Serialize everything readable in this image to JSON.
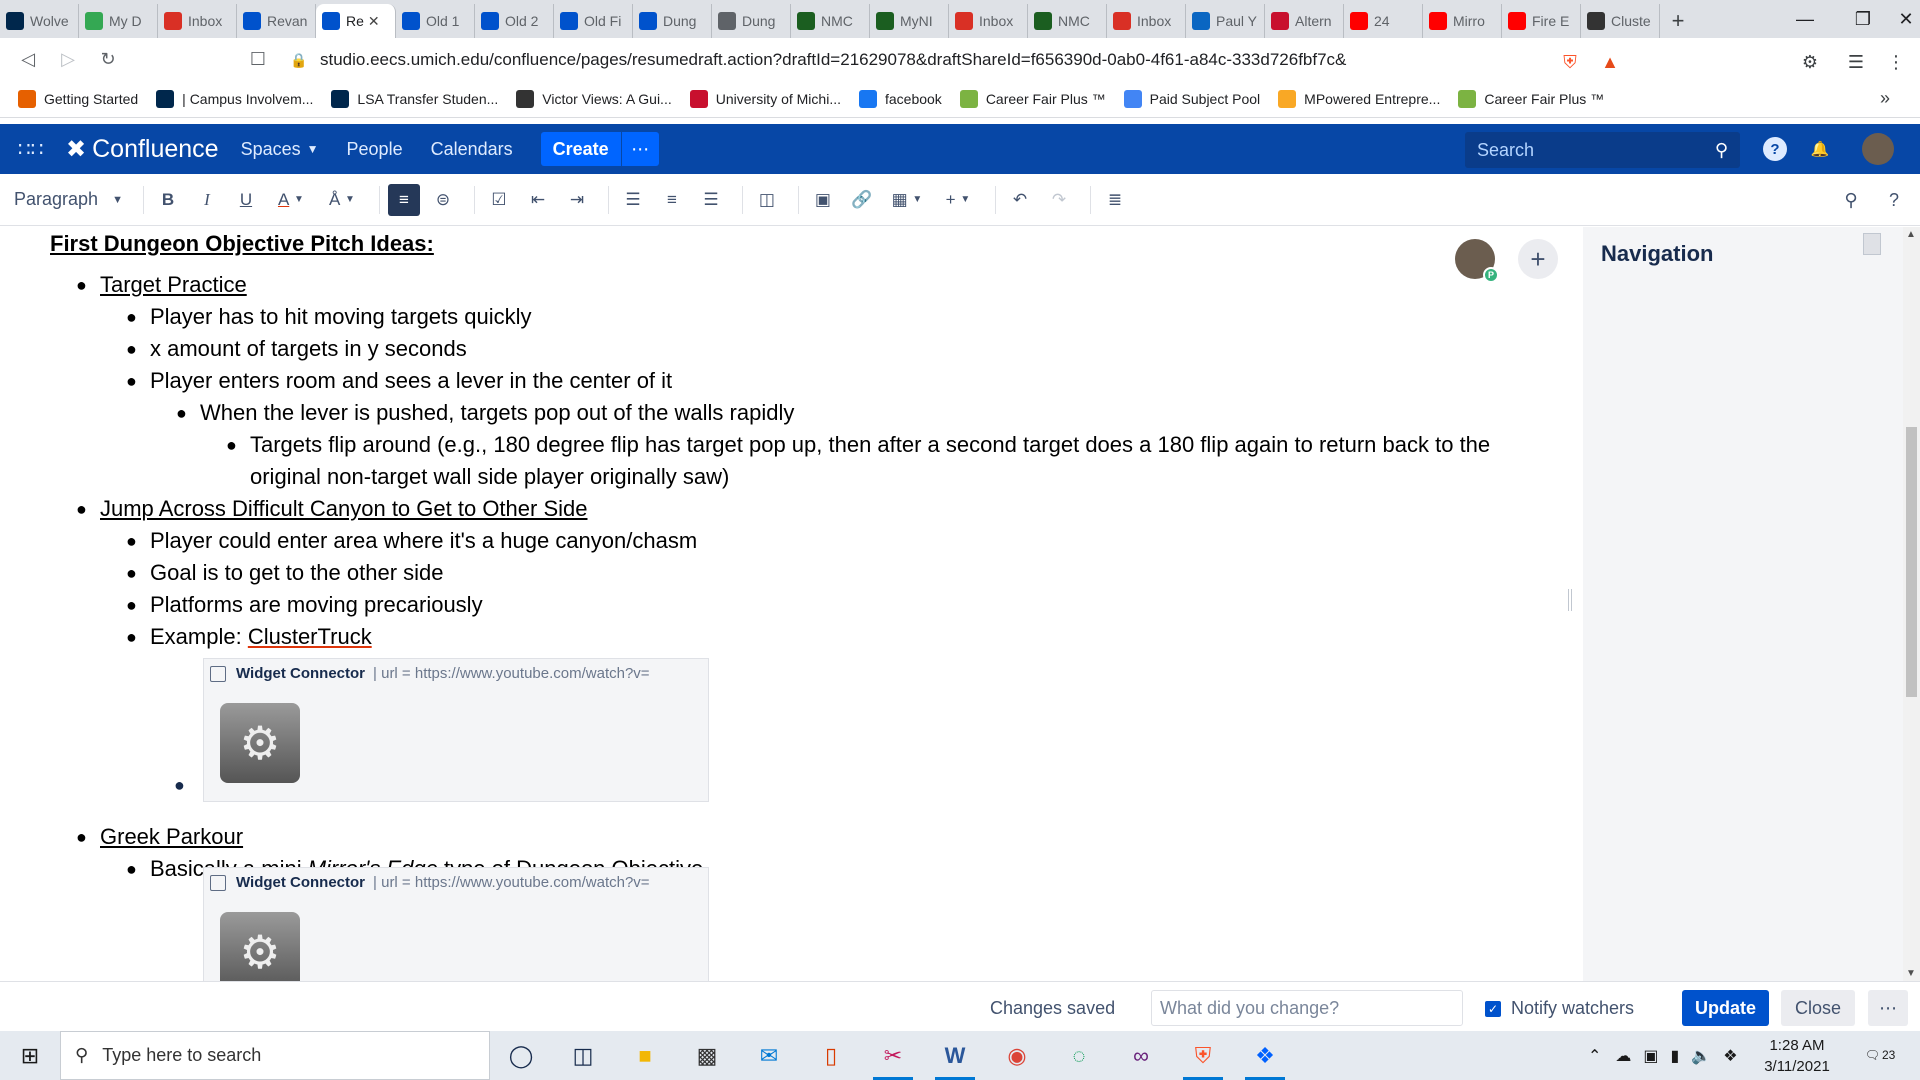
{
  "browser": {
    "tabs": [
      {
        "label": "Wolve",
        "icon": "umich-icon",
        "color": "#00274c"
      },
      {
        "label": "My D",
        "icon": "google-drive-icon",
        "color": "#34a853"
      },
      {
        "label": "Inbox",
        "icon": "gmail-icon",
        "color": "#d93025"
      },
      {
        "label": "Revan",
        "icon": "confluence-icon",
        "color": "#0052cc"
      },
      {
        "label": "Re",
        "icon": "confluence-icon",
        "color": "#0052cc",
        "active": true
      },
      {
        "label": "Old 1",
        "icon": "confluence-icon",
        "color": "#0052cc"
      },
      {
        "label": "Old 2",
        "icon": "confluence-icon",
        "color": "#0052cc"
      },
      {
        "label": "Old Fi",
        "icon": "confluence-icon",
        "color": "#0052cc"
      },
      {
        "label": "Dung",
        "icon": "confluence-icon",
        "color": "#0052cc"
      },
      {
        "label": "Dung",
        "icon": "globe-icon",
        "color": "#5f6368"
      },
      {
        "label": "NMC",
        "icon": "nmc-icon",
        "color": "#1b5e20"
      },
      {
        "label": "MyNI",
        "icon": "nmc-icon",
        "color": "#1b5e20"
      },
      {
        "label": "Inbox",
        "icon": "gmail-icon",
        "color": "#d93025"
      },
      {
        "label": "NMC",
        "icon": "nmc-icon",
        "color": "#1b5e20"
      },
      {
        "label": "Inbox",
        "icon": "gmail-icon",
        "color": "#d93025"
      },
      {
        "label": "Paul Y",
        "icon": "linkedin-icon",
        "color": "#0a66c2"
      },
      {
        "label": "Altern",
        "icon": "bandcamp-icon",
        "color": "#c8102e"
      },
      {
        "label": "24",
        "icon": "youtube-icon",
        "color": "#ff0000"
      },
      {
        "label": "Mirro",
        "icon": "youtube-icon",
        "color": "#ff0000"
      },
      {
        "label": "Fire E",
        "icon": "youtube-icon",
        "color": "#ff0000"
      },
      {
        "label": "Cluste",
        "icon": "wikipedia-icon",
        "color": "#333333"
      }
    ],
    "url": "studio.eecs.umich.edu/confluence/pages/resumedraft.action?draftId=21629078&draftShareId=f656390d-0ab0-4f61-a84c-333d726fbf7c&",
    "bookmarks": [
      {
        "label": "Getting Started",
        "color": "#e66000"
      },
      {
        "label": "| Campus Involvem...",
        "color": "#00274c"
      },
      {
        "label": "LSA Transfer Studen...",
        "color": "#00274c"
      },
      {
        "label": "Victor Views: A Gui...",
        "color": "#333333"
      },
      {
        "label": "University of Michi...",
        "color": "#c8102e"
      },
      {
        "label": "facebook",
        "color": "#1877f2"
      },
      {
        "label": "Career Fair Plus ™",
        "color": "#7cb342"
      },
      {
        "label": "Paid Subject Pool",
        "color": "#4285f4"
      },
      {
        "label": "MPowered Entrepre...",
        "color": "#f9a825"
      },
      {
        "label": "Career Fair Plus ™",
        "color": "#7cb342"
      }
    ]
  },
  "confluence": {
    "logo": "Confluence",
    "nav": {
      "spaces": "Spaces",
      "people": "People",
      "calendars": "Calendars"
    },
    "create": "Create",
    "search_placeholder": "Search",
    "accent": "#0747a6"
  },
  "toolbar": {
    "paragraph": "Paragraph"
  },
  "document": {
    "heading": "First Dungeon Objective Pitch Ideas:",
    "items": [
      {
        "text": "Target Practice",
        "level": 1,
        "link": true
      },
      {
        "text": "Player has to hit moving targets quickly",
        "level": 2
      },
      {
        "text": "x amount of targets in y seconds",
        "level": 2
      },
      {
        "text": "Player enters room and sees a lever in the center of it",
        "level": 2
      },
      {
        "text": "When the lever is pushed, targets pop out of the walls rapidly",
        "level": 3
      },
      {
        "text": "Targets flip around (e.g., 180 degree flip has target pop up, then after a second target does a 180 flip again to return back to the original non-target wall side player originally saw)",
        "level": 4
      },
      {
        "text": "Jump Across Difficult Canyon to Get to Other Side",
        "level": 1,
        "link": true
      },
      {
        "text": "Player could enter area where it's a huge canyon/chasm",
        "level": 2
      },
      {
        "text": "Goal is to get to the other side",
        "level": 2
      },
      {
        "text": "Platforms are moving precariously",
        "level": 2
      },
      {
        "text": "Example: ",
        "link_text": "ClusterTruck",
        "level": 2
      },
      {
        "text": "Greek Parkour",
        "level": 1,
        "link": true
      },
      {
        "text_before": "Basically a mini ",
        "italic": "Mirror's Edge",
        "text_after": " type of Dungeon Objective",
        "level": 2
      }
    ],
    "widgets": [
      {
        "title": "Widget Connector",
        "param": "| url = https://www.youtube.com/watch?v="
      },
      {
        "title": "Widget Connector",
        "param": "| url = https://www.youtube.com/watch?v="
      }
    ]
  },
  "collaborator": {
    "badge": "P"
  },
  "side_panel": {
    "title": "Navigation"
  },
  "footer": {
    "status": "Changes saved",
    "change_placeholder": "What did you change?",
    "notify": "Notify watchers",
    "update": "Update",
    "close": "Close"
  },
  "taskbar": {
    "search_placeholder": "Type here to search",
    "time": "1:28 AM",
    "date": "3/11/2021",
    "notifications": "23"
  }
}
